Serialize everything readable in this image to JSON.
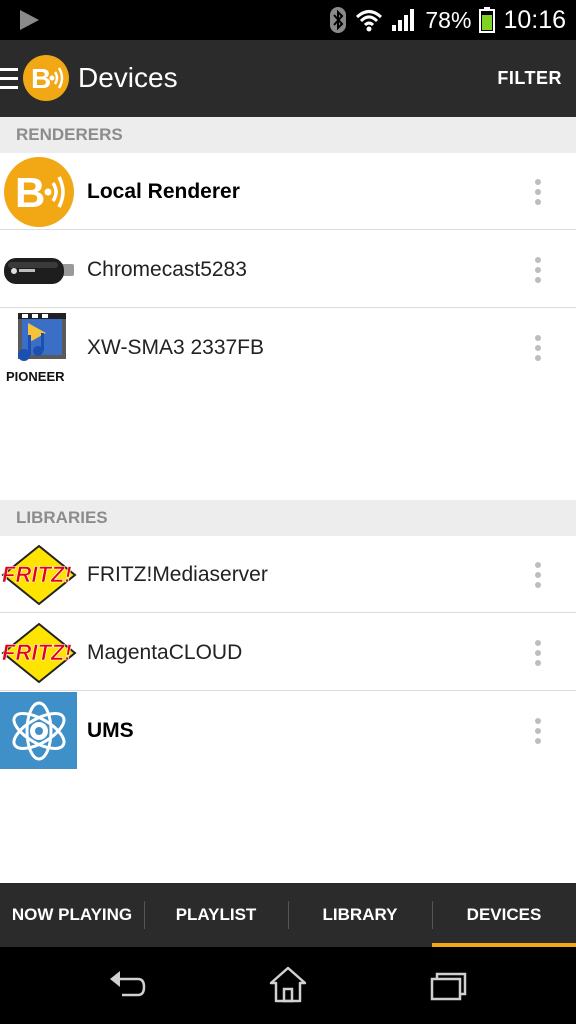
{
  "status_bar": {
    "battery": "78%",
    "time": "10:16",
    "icons": [
      "play-icon",
      "bluetooth-icon",
      "wifi-icon",
      "signal-icon",
      "battery-icon"
    ]
  },
  "action_bar": {
    "title": "Devices",
    "filter": "FILTER",
    "icons": [
      "menu-icon",
      "bubbleupnp-logo"
    ]
  },
  "renderers": {
    "header": "RENDERERS",
    "items": [
      {
        "name": "Local Renderer",
        "icon": "bubbleupnp-logo"
      },
      {
        "name": "Chromecast5283",
        "icon": "chromecast-device-icon"
      },
      {
        "name": "XW-SMA3 2337FB",
        "icon": "pioneer-media-icon",
        "icon_text": "PIONEER"
      }
    ]
  },
  "libraries": {
    "header": "LIBRARIES",
    "items": [
      {
        "name": "FRITZ!Mediaserver",
        "icon": "fritz-logo",
        "icon_text": "FRITZ!"
      },
      {
        "name": "MagentaCLOUD",
        "icon": "fritz-logo",
        "icon_text": "FRITZ!"
      },
      {
        "name": "UMS",
        "icon": "ums-logo"
      }
    ]
  },
  "tabs": [
    {
      "label": "NOW PLAYING"
    },
    {
      "label": "PLAYLIST"
    },
    {
      "label": "LIBRARY"
    },
    {
      "label": "DEVICES",
      "selected": true
    }
  ],
  "colors": {
    "accent": "#f2a714",
    "action_bar": "#2b2b2b",
    "section_header_bg": "#ededed",
    "section_header_text": "#8c8c8c"
  },
  "nav_bar": {
    "icons": [
      "back-icon",
      "home-icon",
      "recents-icon"
    ]
  }
}
